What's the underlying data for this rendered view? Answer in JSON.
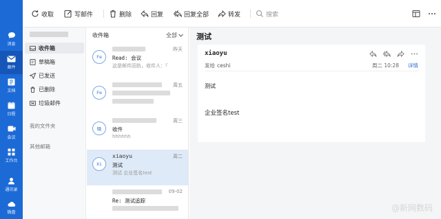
{
  "rail": {
    "items": [
      {
        "label": "消息",
        "icon": "chat-icon"
      },
      {
        "label": "邮件",
        "icon": "mail-icon"
      },
      {
        "label": "文档",
        "icon": "document-icon"
      },
      {
        "label": "日程",
        "icon": "calendar-icon"
      },
      {
        "label": "会议",
        "icon": "video-icon"
      },
      {
        "label": "工作台",
        "icon": "grid-icon"
      },
      {
        "label": "通讯录",
        "icon": "contacts-icon"
      },
      {
        "label": "微盘",
        "icon": "drive-icon"
      }
    ]
  },
  "toolbar": {
    "receive": "收取",
    "compose": "写邮件",
    "delete": "删除",
    "reply": "回复",
    "reply_all": "回复全部",
    "forward": "转发",
    "search_placeholder": "搜索"
  },
  "folders": {
    "items": [
      {
        "label": "收件箱"
      },
      {
        "label": "草稿箱"
      },
      {
        "label": "已发送"
      },
      {
        "label": "已删除"
      },
      {
        "label": "垃圾邮件"
      }
    ],
    "my_folders": "我的文件夹",
    "other_mailboxes": "其他邮箱"
  },
  "list": {
    "title": "收件箱",
    "filter": "全部",
    "messages": [
      {
        "avatar": "Fe",
        "time": "昨天",
        "subject": "Read: 会议",
        "summary": "这是邮件回执，收件人：『"
      },
      {
        "avatar": "Fe",
        "time": "周五",
        "subject": "",
        "summary": ""
      },
      {
        "avatar": "晓",
        "time": "周三",
        "subject": "收件",
        "summary": "hhhhhh"
      },
      {
        "avatar": "Xi",
        "from": "xiaoyu",
        "time": "周二",
        "subject": "测试",
        "summary": "测试 企业签名test"
      },
      {
        "avatar": "",
        "time": "09-02",
        "subject": "Re: 测试追踪",
        "summary": ""
      }
    ]
  },
  "reader": {
    "title": "测试",
    "sender": "xiaoyu",
    "to_label": "发给",
    "to_value": "ceshi",
    "date": "周二 10:28",
    "detail": "详情",
    "body_line1": "测试",
    "body_line2": "企业签名test"
  },
  "watermark": "@新网数码",
  "colors": {
    "rail": "#1c6ad6",
    "accent": "#2f6fd1",
    "selected": "#dfeaf8"
  }
}
